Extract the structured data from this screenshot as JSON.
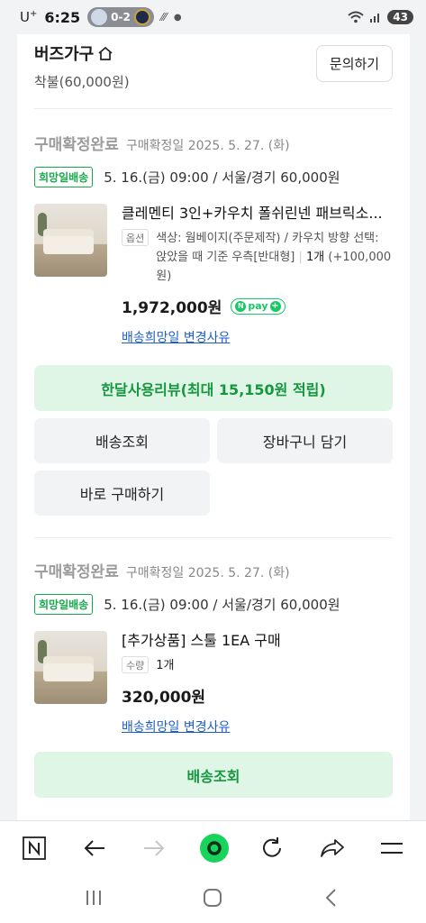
{
  "status_bar": {
    "carrier": "U",
    "carrier_sup": "+",
    "time": "6:25",
    "score": "0-2",
    "battery": "43"
  },
  "seller": {
    "name": "버즈가구",
    "shipping": "착불(60,000원)",
    "inquiry_label": "문의하기"
  },
  "orders": [
    {
      "status": "구매확정완료",
      "confirm_date": "구매확정일 2025. 5. 27. (화)",
      "badge": "희망일배송",
      "delivery": "5. 16.(금) 09:00 / 서울/경기 60,000원",
      "product_name": "클레멘티 3인+카우치 폴쉬린넨 패브릭소...",
      "option_tag": "옵션",
      "option_text": "색상: 웜베이지(주문제작) / 카우치 방향 선택: 앉았을 때 기준 우측[반대형]",
      "quantity": "1개",
      "option_extra": "(+100,000원)",
      "price": "1,972,000원",
      "npay_label": "pay",
      "change_reason_link": "배송희망일 변경사유",
      "review_button": "한달사용리뷰(최대 15,150원 적립)",
      "track_button": "배송조회",
      "cart_button": "장바구니 담기",
      "buy_button": "바로 구매하기"
    },
    {
      "status": "구매확정완료",
      "confirm_date": "구매확정일 2025. 5. 27. (화)",
      "badge": "희망일배송",
      "delivery": "5. 16.(금) 09:00 / 서울/경기 60,000원",
      "product_name": "[추가상품] 스툴 1EA 구매",
      "option_tag": "수량",
      "quantity": "1개",
      "price": "320,000원",
      "change_reason_link": "배송희망일 변경사유",
      "track_button": "배송조회"
    }
  ],
  "browser_nav": {
    "icons": [
      "naver-n-icon",
      "back-arrow-icon",
      "forward-arrow-icon",
      "home-dot-icon",
      "reload-icon",
      "share-icon",
      "menu-icon"
    ]
  },
  "colors": {
    "accent_green": "#15963f",
    "green_bg": "#dff6e6",
    "link_blue": "#1d5fc6",
    "npay_green": "#17c964"
  }
}
